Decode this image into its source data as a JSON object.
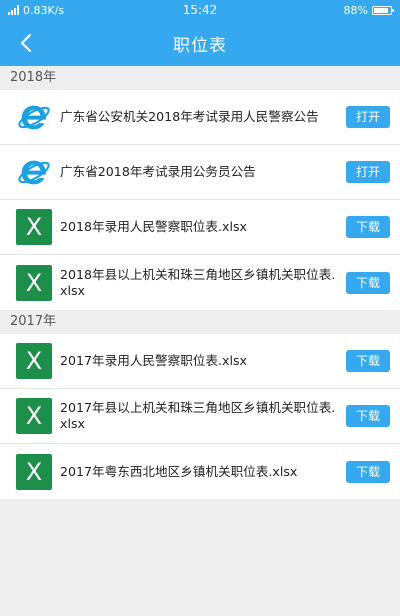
{
  "status_bar": {
    "carrier": "4G",
    "network_speed": "0.83K/s",
    "time": "15:42",
    "battery": "88%",
    "battery_level": 0.88
  },
  "nav": {
    "title": "职位表"
  },
  "colors": {
    "brand": "#35a8ef",
    "excel": "#1e8f4a",
    "ie": "#1ba1e2"
  },
  "sections": [
    {
      "year_label": "2018年",
      "items": [
        {
          "icon": "ie-icon",
          "title": "广东省公安机关2018年考试录用人民警察公告",
          "action": "打开"
        },
        {
          "icon": "ie-icon",
          "title": "广东省2018年考试录用公务员公告",
          "action": "打开"
        },
        {
          "icon": "excel-icon",
          "icon_text": "X",
          "title": "2018年录用人民警察职位表.xlsx",
          "action": "下载"
        },
        {
          "icon": "excel-icon",
          "icon_text": "X",
          "title": "2018年县以上机关和珠三角地区乡镇机关职位表.xlsx",
          "action": "下载"
        }
      ]
    },
    {
      "year_label": "2017年",
      "items": [
        {
          "icon": "excel-icon",
          "icon_text": "X",
          "title": "2017年录用人民警察职位表.xlsx",
          "action": "下载"
        },
        {
          "icon": "excel-icon",
          "icon_text": "X",
          "title": "2017年县以上机关和珠三角地区乡镇机关职位表.xlsx",
          "action": "下载"
        },
        {
          "icon": "excel-icon",
          "icon_text": "X",
          "title": "2017年粤东西北地区乡镇机关职位表.xlsx",
          "action": "下载"
        }
      ]
    }
  ]
}
